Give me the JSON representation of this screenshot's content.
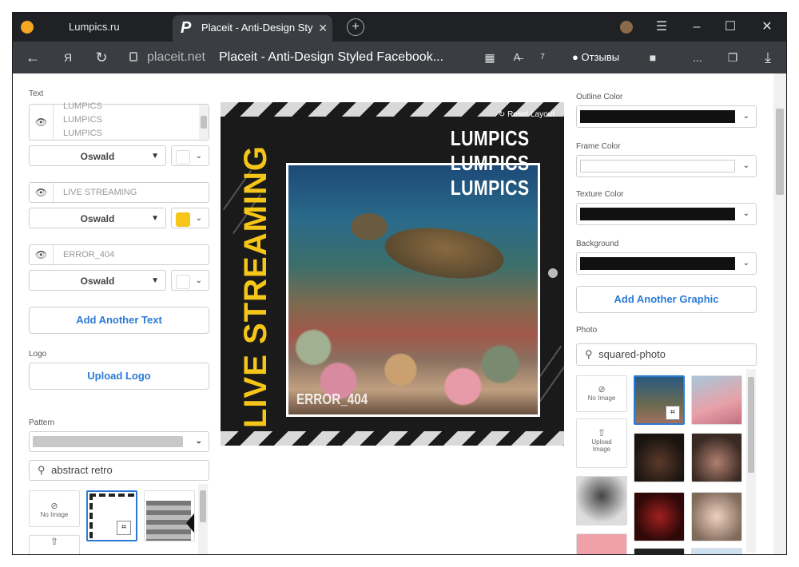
{
  "browser": {
    "tabs": [
      {
        "label": "Lumpics.ru",
        "active": false
      },
      {
        "label": "Placeit - Anti-Design Sty",
        "active": true
      }
    ],
    "new_tab": "+",
    "address": {
      "domain": "placeit.net",
      "title": "Placeit - Anti-Design Styled Facebook..."
    },
    "reviews_label": "Отзывы",
    "more_label": "...",
    "badge_count": "7"
  },
  "left_panel": {
    "text_label": "Text",
    "text_lines": [
      "LUMPICS",
      "LUMPICS",
      "LUMPICS"
    ],
    "text_fields": [
      {
        "font": "Oswald",
        "swatch": "#ffffff"
      },
      {
        "value": "LIVE STREAMING",
        "font": "Oswald",
        "swatch": "#f5c518"
      },
      {
        "value": "ERROR_404",
        "font": "Oswald",
        "swatch": "#ffffff"
      }
    ],
    "add_text_button": "Add Another Text",
    "logo_label": "Logo",
    "upload_logo_button": "Upload Logo",
    "pattern_label": "Pattern",
    "pattern_search": "abstract retro",
    "no_image_label": "No Image"
  },
  "canvas": {
    "reset_layout": "Reset Layout",
    "headline_lines": [
      "LUMPICS",
      "LUMPICS",
      "LUMPICS"
    ],
    "vertical_text": "LIVE STREAMING",
    "error_text": "ERROR_404"
  },
  "right_panel": {
    "outline_color_label": "Outline Color",
    "outline_color": "#111111",
    "frame_color_label": "Frame Color",
    "frame_color": "#ffffff",
    "texture_color_label": "Texture Color",
    "texture_color": "#111111",
    "background_label": "Background",
    "background_color": "#111111",
    "add_graphic_button": "Add Another Graphic",
    "photo_label": "Photo",
    "photo_search": "squared-photo",
    "no_image_label": "No Image",
    "upload_image_label": "Upload Image"
  }
}
